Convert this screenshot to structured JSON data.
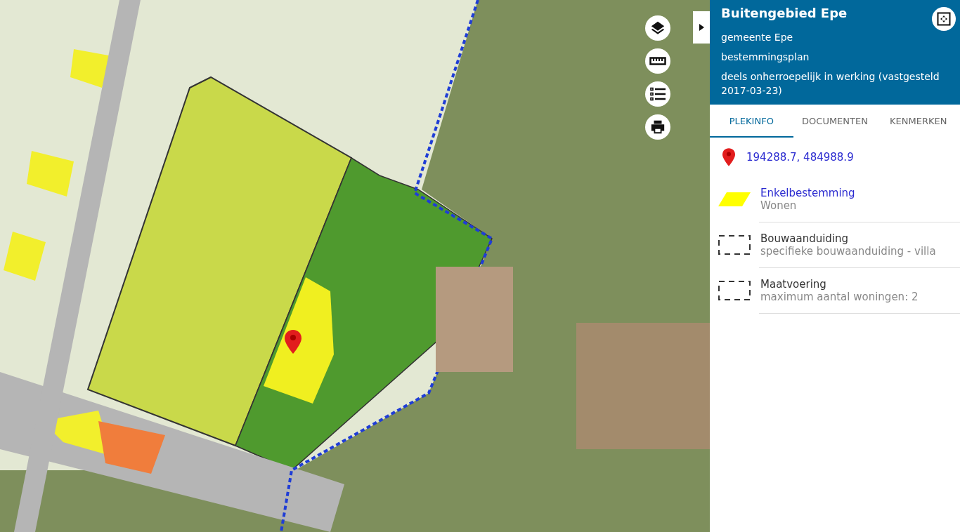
{
  "header": {
    "title": "Buitengebied Epe",
    "lines": [
      "gemeente Epe",
      "bestemmingsplan",
      "deels onherroepelijk in werking (vastgesteld 2017-03-23)"
    ]
  },
  "tabs": [
    {
      "label": "PLEKINFO",
      "selected": true
    },
    {
      "label": "DOCUMENTEN",
      "selected": false
    },
    {
      "label": "KENMERKEN",
      "selected": false
    }
  ],
  "location": {
    "coordinates": "194288.7, 484988.9"
  },
  "legend": [
    {
      "kind": "polygon",
      "color": "#ffff00",
      "title": "Enkelbestemming",
      "subtitle": "Wonen",
      "link": true
    },
    {
      "kind": "dashed",
      "title": "Bouwaanduiding",
      "subtitle": "specifieke bouwaanduiding - villa",
      "link": false
    },
    {
      "kind": "dashed",
      "title": "Maatvoering",
      "subtitle": "maximum aantal woningen: 2",
      "link": false
    }
  ]
}
